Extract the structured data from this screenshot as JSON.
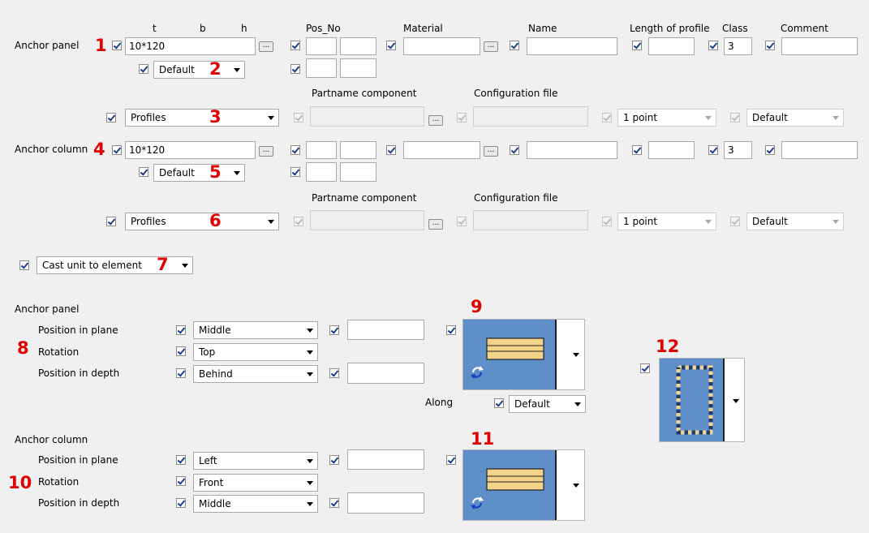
{
  "headers": {
    "t": "t",
    "b": "b",
    "h": "h",
    "pos_no": "Pos_No",
    "material": "Material",
    "name": "Name",
    "length": "Length of profile",
    "class": "Class",
    "comment": "Comment"
  },
  "sub_headers": {
    "partname": "Partname component",
    "config": "Configuration file"
  },
  "anchor_panel": {
    "label": "Anchor panel",
    "profile": "10*120",
    "default": "Default",
    "class": "3",
    "profiles": "Profiles",
    "point": "1 point",
    "config_default": "Default"
  },
  "anchor_column": {
    "label": "Anchor column",
    "profile": "10*120",
    "default": "Default",
    "class": "3",
    "profiles": "Profiles",
    "point": "1 point",
    "config_default": "Default"
  },
  "cast_unit": "Cast unit to element",
  "panel_pos": {
    "title": "Anchor panel",
    "plane_label": "Position in plane",
    "rotation_label": "Rotation",
    "depth_label": "Position in depth",
    "plane": "Middle",
    "rotation": "Top",
    "depth": "Behind"
  },
  "along": {
    "label": "Along",
    "value": "Default"
  },
  "column_pos": {
    "title": "Anchor column",
    "plane_label": "Position in plane",
    "rotation_label": "Rotation",
    "depth_label": "Position in depth",
    "plane": "Left",
    "rotation": "Front",
    "depth": "Middle"
  },
  "markers": {
    "m1": "1",
    "m2": "2",
    "m3": "3",
    "m4": "4",
    "m5": "5",
    "m6": "6",
    "m7": "7",
    "m8": "8",
    "m9": "9",
    "m10": "10",
    "m11": "11",
    "m12": "12"
  },
  "colors": {
    "accent_red": "#e00000",
    "picture_blue": "#5e8fc8",
    "profile_fill": "#f4d48a"
  },
  "icons": [
    "browse-dots-icon",
    "dropdown-arrow-icon",
    "rotate-arrows-icon"
  ]
}
